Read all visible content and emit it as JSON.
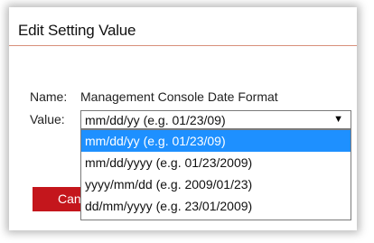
{
  "dialog": {
    "title": "Edit Setting Value"
  },
  "setting": {
    "name_label": "Name:",
    "name_value": "Management Console Date Format",
    "value_label": "Value:",
    "selected_value": "mm/dd/yy (e.g. 01/23/09)",
    "options": [
      "mm/dd/yy (e.g. 01/23/09)",
      "mm/dd/yyyy (e.g. 01/23/2009)",
      "yyyy/mm/dd (e.g. 2009/01/23)",
      "dd/mm/yyyy (e.g. 23/01/2009)"
    ],
    "selected_index": 0
  },
  "buttons": {
    "cancel_label": "Cancel"
  },
  "icons": {
    "dropdown_arrow": "dropdown-arrow-icon"
  },
  "colors": {
    "accent": "#c4161c",
    "selection": "#1e90ff",
    "title_rule": "#d8907a"
  }
}
